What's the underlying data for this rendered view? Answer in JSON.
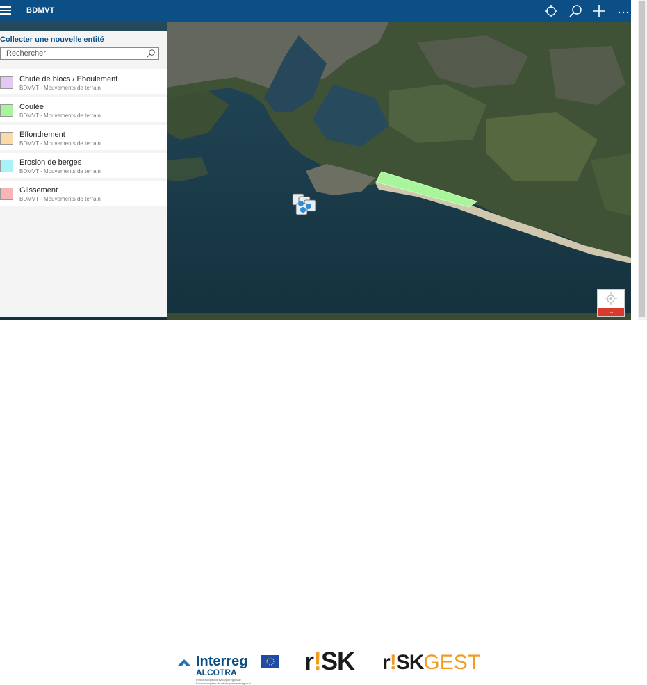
{
  "app": {
    "title": "BDMVT"
  },
  "toolbar": {
    "icons": [
      "locate-icon",
      "search-icon",
      "plus-icon",
      "more-icon"
    ],
    "more_label": "···"
  },
  "panel": {
    "title": "Collecter une nouvelle entité",
    "search_placeholder": "Rechercher",
    "entities": [
      {
        "name": "Chute de blocs / Eboulement",
        "layer": "BDMVT - Mouvements de terrain",
        "color": "#e5c7f5"
      },
      {
        "name": "Coulée",
        "layer": "BDMVT - Mouvements de terrain",
        "color": "#a9f59b"
      },
      {
        "name": "Effondrement",
        "layer": "BDMVT - Mouvements de terrain",
        "color": "#fbd9a8"
      },
      {
        "name": "Erosion de berges",
        "layer": "BDMVT - Mouvements de terrain",
        "color": "#a9f2f7"
      },
      {
        "name": "Glissement",
        "layer": "BDMVT - Mouvements de terrain",
        "color": "#f7b5b8"
      }
    ]
  },
  "map": {
    "coulee_polygon_color": "#a9f59b",
    "location_widget_label": "..."
  },
  "footer": {
    "interreg": "Interreg",
    "alcotra": "ALCOTRA",
    "fine_1": "Fondo europeo di sviluppo regionale",
    "fine_2": "Fonds européen de développement régional",
    "risk_r": "r",
    "risk_bang": "!",
    "risk_sk": "SK",
    "riskgest_r": "r",
    "riskgest_bang": "!",
    "riskgest_sk": "SK",
    "riskgest_gest": "GEST"
  }
}
